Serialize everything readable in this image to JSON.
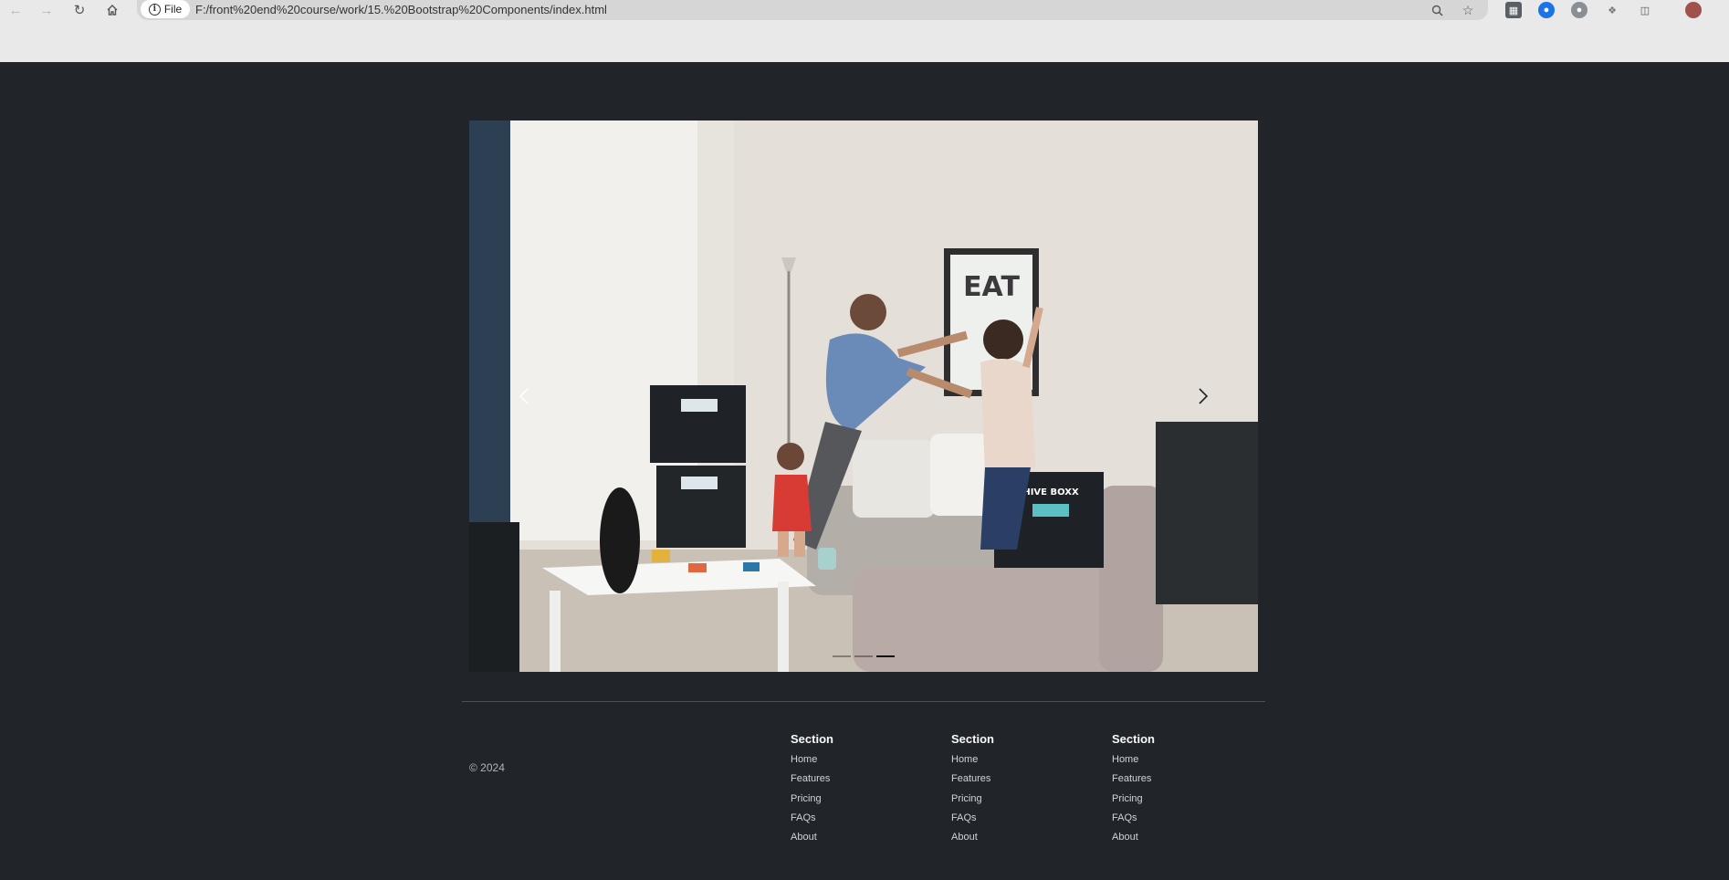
{
  "browser": {
    "file_chip": "File",
    "url": "F:/front%20end%20course/work/15.%20Bootstrap%20Components/index.html"
  },
  "carousel": {
    "slides": 3,
    "active_slide": 3,
    "sign_text": "EAT",
    "box_label": "HIVE BOXX"
  },
  "footer": {
    "copyright": "© 2024",
    "sections": [
      {
        "title": "Section",
        "links": [
          "Home",
          "Features",
          "Pricing",
          "FAQs",
          "About"
        ]
      },
      {
        "title": "Section",
        "links": [
          "Home",
          "Features",
          "Pricing",
          "FAQs",
          "About"
        ]
      },
      {
        "title": "Section",
        "links": [
          "Home",
          "Features",
          "Pricing",
          "FAQs",
          "About"
        ]
      }
    ]
  },
  "colors": {
    "page_bg": "#212529",
    "chrome_bg": "#e9e9e9"
  },
  "icons": [
    "back-icon",
    "forward-icon",
    "reload-icon",
    "home-icon",
    "info-icon",
    "zoom-icon",
    "star-icon",
    "extension-icon",
    "profile-avatar"
  ]
}
